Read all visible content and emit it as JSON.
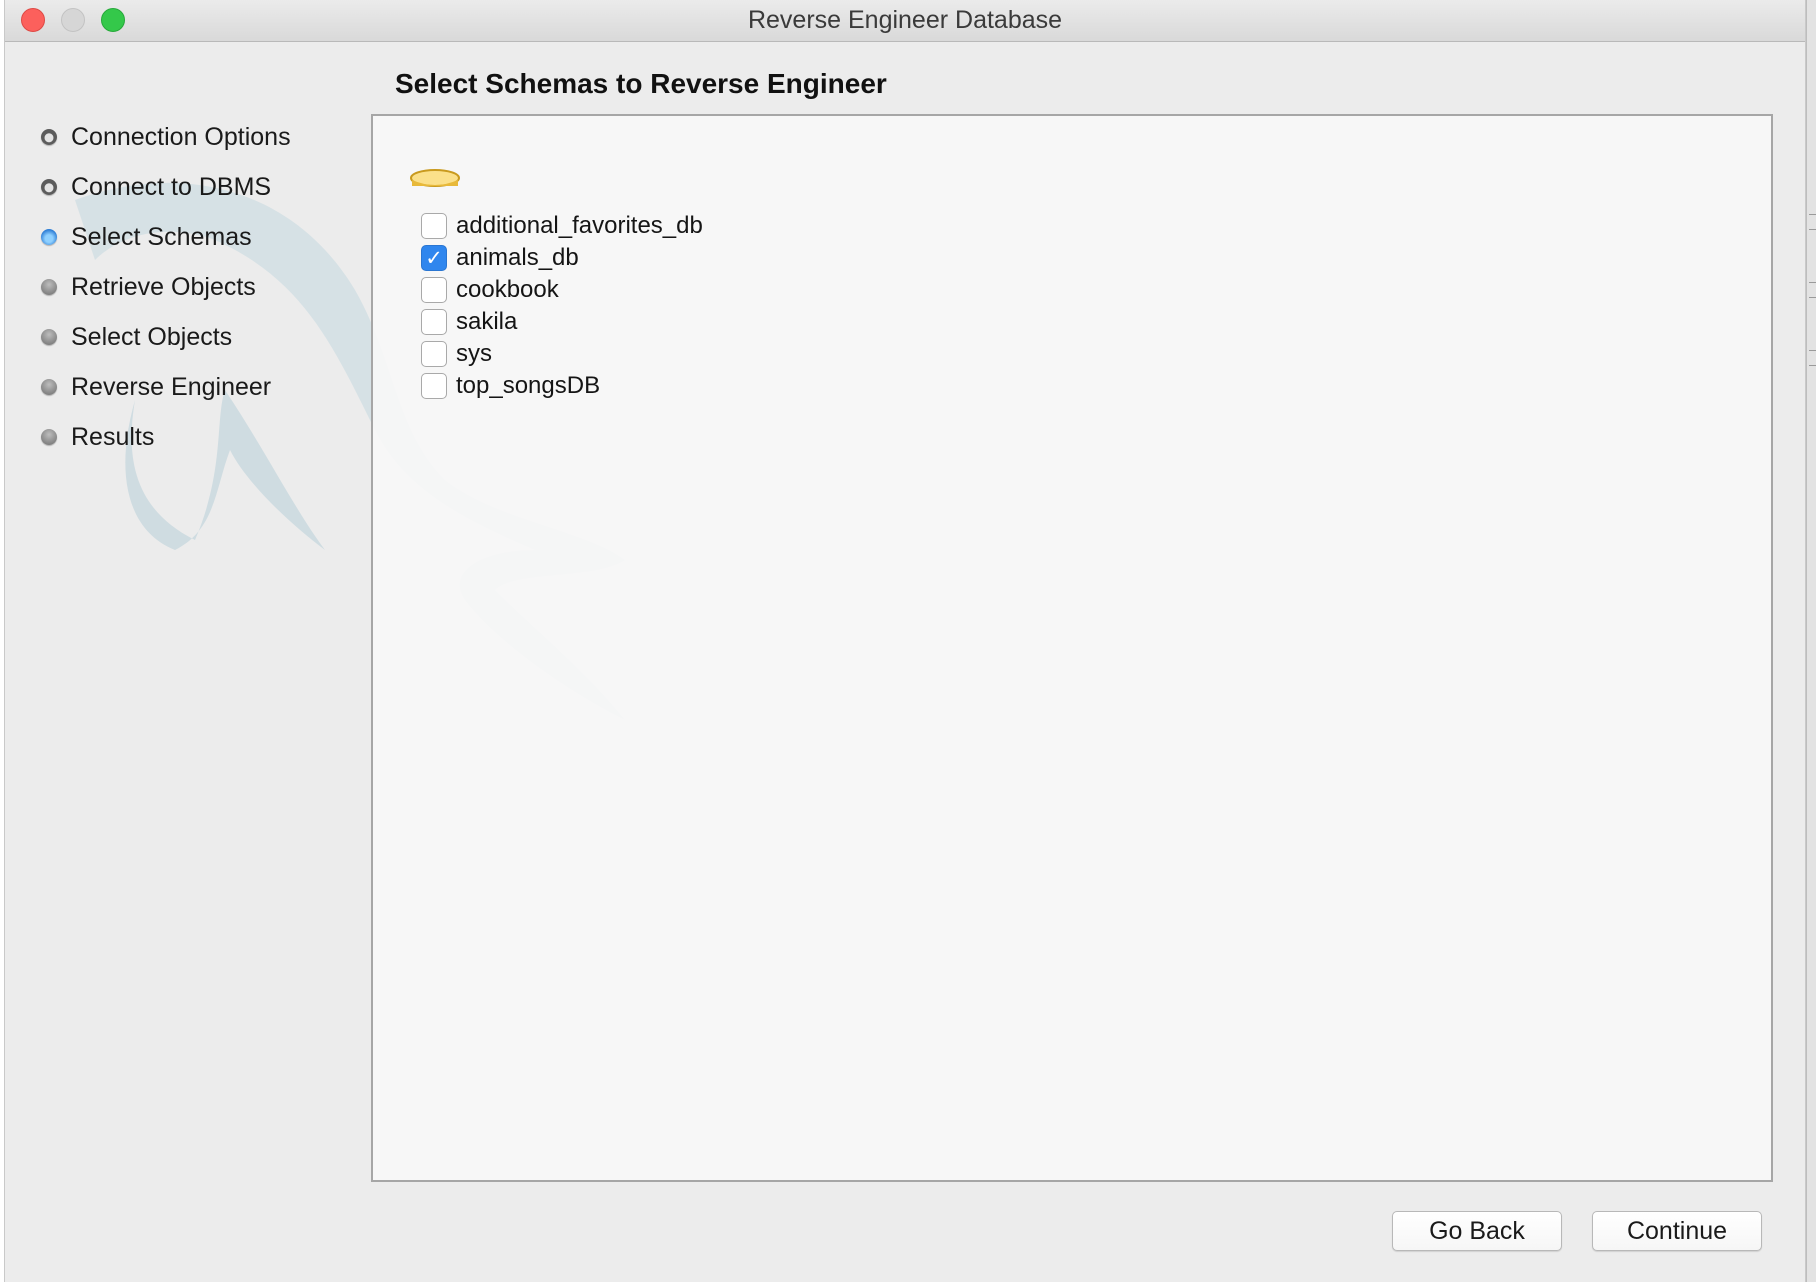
{
  "window": {
    "title": "Reverse Engineer Database"
  },
  "sidebar": {
    "steps": [
      {
        "label": "Connection Options",
        "state": "done"
      },
      {
        "label": "Connect to DBMS",
        "state": "done"
      },
      {
        "label": "Select Schemas",
        "state": "current"
      },
      {
        "label": "Retrieve Objects",
        "state": "pending"
      },
      {
        "label": "Select Objects",
        "state": "pending"
      },
      {
        "label": "Reverse Engineer",
        "state": "pending"
      },
      {
        "label": "Results",
        "state": "pending"
      }
    ]
  },
  "main": {
    "title": "Select Schemas to Reverse Engineer",
    "server_icon": "database-icon",
    "schemas": [
      {
        "name": "additional_favorites_db",
        "checked": false
      },
      {
        "name": "animals_db",
        "checked": true
      },
      {
        "name": "cookbook",
        "checked": false
      },
      {
        "name": "sakila",
        "checked": false
      },
      {
        "name": "sys",
        "checked": false
      },
      {
        "name": "top_songsDB",
        "checked": false
      }
    ]
  },
  "buttons": {
    "back_label": "Go Back",
    "continue_label": "Continue"
  },
  "colors": {
    "checkbox_checked": "#2f86ee",
    "close": "#fc605c",
    "zoom": "#34c84a"
  }
}
